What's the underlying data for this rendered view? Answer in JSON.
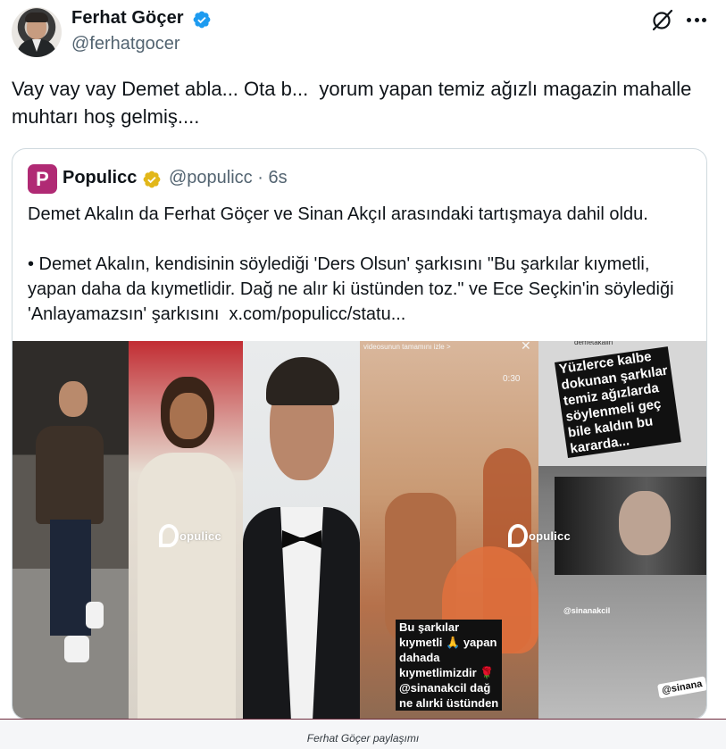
{
  "tweet": {
    "author_name": "Ferhat Göçer",
    "author_handle": "@ferhatgocer",
    "text": "Vay vay vay Demet abla... Ota b...  yorum yapan temiz ağızlı magazin mahalle muhtarı hoş gelmiş....",
    "icons": {
      "verified": "verified-badge-icon",
      "grok": "grok-icon",
      "more": "more-options-icon"
    },
    "colors": {
      "verified": "#1d9bf0",
      "text": "#0f1419",
      "secondary": "#536471"
    }
  },
  "quote": {
    "avatar_letter": "P",
    "name": "Populicc",
    "handle": "@populicc",
    "separator": "·",
    "time": "6s",
    "text": "Demet Akalın da Ferhat Göçer ve Sinan Akçıl arasındaki tartışmaya dahil oldu.\n\n• Demet Akalın, kendisinin söylediği 'Ders Olsun' şarkısını \"Bu şarkılar kıymetli, yapan daha da kıymetlidir. Dağ ne alır ki üstünden toz.\" ve Ece Seçkin'in söylediği 'Anlayamazsın' şarkısını  x.com/populicc/statu...",
    "colors": {
      "brand": "#b02a74",
      "badge": "#e2b719",
      "border": "#cfd9de"
    }
  },
  "media": {
    "watermark": "opulicc",
    "story1": {
      "top_label": "videosunun tamamını izle >",
      "time": "0:30",
      "close": "✕",
      "sticker_text": "Bu şarkılar\nkıymetli 🙏 yapan\ndahada\nkıymetlimizdir 🌹\n@sinanakcil dağ\nne alırki üstünden"
    },
    "story2": {
      "top_label": "demetakalin",
      "text": "Yüzlerce kalbe\ndokunan şarkılar\ntemiz ağızlarda\nsöylenmeli geç\nbile kaldın bu\nkararda...",
      "photo_tag": "@sinanakcil",
      "mention_sticker": "@sinana"
    }
  },
  "caption": "Ferhat Göçer paylaşımı"
}
